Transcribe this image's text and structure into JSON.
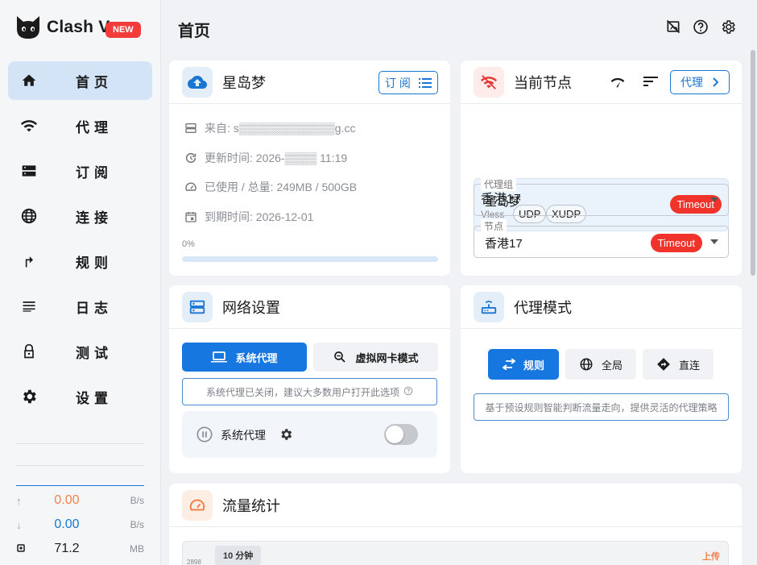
{
  "app": {
    "name": "Clash V",
    "badge": "NEW"
  },
  "page": {
    "title": "首页"
  },
  "sidebar": {
    "items": [
      {
        "label": "首页",
        "icon": "home-icon"
      },
      {
        "label": "代理",
        "icon": "wifi-icon"
      },
      {
        "label": "订阅",
        "icon": "subscription-icon"
      },
      {
        "label": "连接",
        "icon": "globe-icon"
      },
      {
        "label": "规则",
        "icon": "route-icon"
      },
      {
        "label": "日志",
        "icon": "log-icon"
      },
      {
        "label": "测试",
        "icon": "lock-icon"
      },
      {
        "label": "设置",
        "icon": "gear-icon"
      }
    ],
    "traffic": {
      "upload": {
        "value": "0.00",
        "unit": "B/s",
        "color": "#f0814d"
      },
      "download": {
        "value": "0.00",
        "unit": "B/s",
        "color": "#1976d2"
      },
      "memory": {
        "value": "71.2",
        "unit": "MB"
      }
    }
  },
  "subscription": {
    "name": "星岛梦",
    "button": "订 阅",
    "from": "来自: s▒▒▒▒▒▒▒▒▒▒▒▒g.cc",
    "updated": "更新时间: 2026-▒▒▒▒ 11:19",
    "used": "已使用 / 总量: 249MB / 500GB",
    "expire": "到期时间: 2026-12-01",
    "percent_label": "0%",
    "percent": 0
  },
  "current_node": {
    "title": "当前节点",
    "proxy_button": "代理",
    "node_name": "香港17",
    "protocol": "Vless",
    "tags": [
      "UDP",
      "XUDP"
    ],
    "status": "Timeout",
    "group_label": "代理组",
    "group_value": "星岛梦",
    "node_label": "节点",
    "node_value": "香港17"
  },
  "network": {
    "title": "网络设置",
    "btn_system": "系统代理",
    "btn_tun": "虚拟网卡模式",
    "note": "系统代理已关闭，建议大多数用户打开此选项",
    "toggle_label": "系统代理",
    "toggle_on": false
  },
  "proxy_mode": {
    "title": "代理模式",
    "btn_rule": "规则",
    "btn_global": "全局",
    "btn_direct": "直连",
    "note": "基于预设规则智能判断流量走向，提供灵活的代理策略"
  },
  "traffic_stats": {
    "title": "流量统计",
    "range": "10 分钟",
    "upload_label": "上传",
    "axis_top": "2898"
  }
}
